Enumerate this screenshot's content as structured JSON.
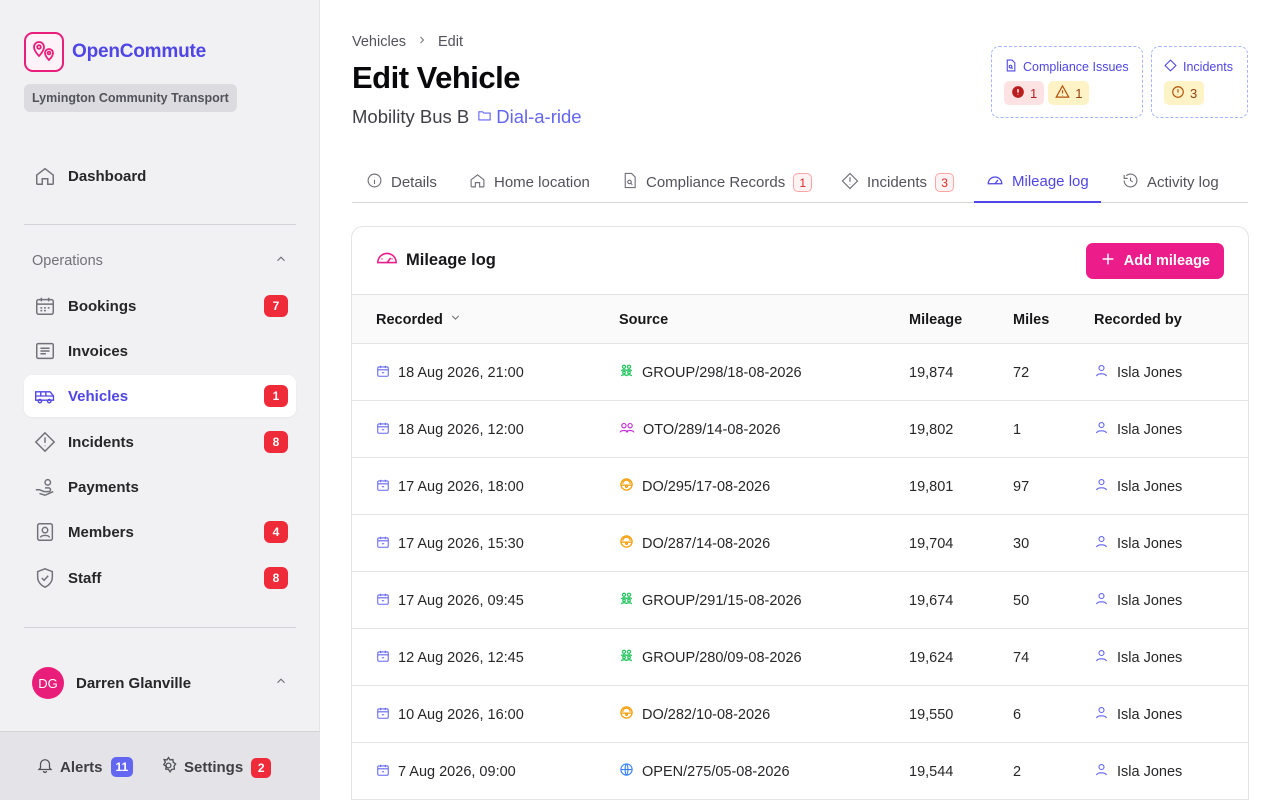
{
  "app": {
    "name": "OpenCommute",
    "organisation": "Lymington Community Transport"
  },
  "sidebar": {
    "dashboard": "Dashboard",
    "section_title": "Operations",
    "items": [
      {
        "label": "Bookings",
        "badge": "7"
      },
      {
        "label": "Invoices",
        "badge": ""
      },
      {
        "label": "Vehicles",
        "badge": "1"
      },
      {
        "label": "Incidents",
        "badge": "8"
      },
      {
        "label": "Payments",
        "badge": ""
      },
      {
        "label": "Members",
        "badge": "4"
      },
      {
        "label": "Staff",
        "badge": "8"
      }
    ],
    "user": {
      "initials": "DG",
      "name": "Darren Glanville"
    },
    "footer": {
      "alerts_label": "Alerts",
      "alerts_count": "11",
      "settings_label": "Settings",
      "settings_count": "2"
    }
  },
  "breadcrumb": {
    "parent": "Vehicles",
    "current": "Edit"
  },
  "page": {
    "title": "Edit Vehicle",
    "vehicle_name": "Mobility Bus B",
    "service": "Dial-a-ride"
  },
  "status_cards": {
    "compliance": {
      "label": "Compliance Issues",
      "critical": "1",
      "warning": "1"
    },
    "incidents": {
      "label": "Incidents",
      "count": "3"
    }
  },
  "tabs": [
    {
      "label": "Details",
      "count": ""
    },
    {
      "label": "Home location",
      "count": ""
    },
    {
      "label": "Compliance Records",
      "count": "1"
    },
    {
      "label": "Incidents",
      "count": "3"
    },
    {
      "label": "Mileage log",
      "count": ""
    },
    {
      "label": "Activity log",
      "count": ""
    }
  ],
  "panel": {
    "title": "Mileage log",
    "add_button": "Add mileage",
    "columns": [
      "Recorded",
      "Source",
      "Mileage",
      "Miles",
      "Recorded by"
    ],
    "rows": [
      {
        "recorded": "18 Aug 2026, 21:00",
        "source": "GROUP/298/18-08-2026",
        "source_type": "group",
        "mileage": "19,874",
        "miles": "72",
        "by": "Isla Jones"
      },
      {
        "recorded": "18 Aug 2026, 12:00",
        "source": "OTO/289/14-08-2026",
        "source_type": "oto",
        "mileage": "19,802",
        "miles": "1",
        "by": "Isla Jones"
      },
      {
        "recorded": "17 Aug 2026, 18:00",
        "source": "DO/295/17-08-2026",
        "source_type": "do",
        "mileage": "19,801",
        "miles": "97",
        "by": "Isla Jones"
      },
      {
        "recorded": "17 Aug 2026, 15:30",
        "source": "DO/287/14-08-2026",
        "source_type": "do",
        "mileage": "19,704",
        "miles": "30",
        "by": "Isla Jones"
      },
      {
        "recorded": "17 Aug 2026, 09:45",
        "source": "GROUP/291/15-08-2026",
        "source_type": "group",
        "mileage": "19,674",
        "miles": "50",
        "by": "Isla Jones"
      },
      {
        "recorded": "12 Aug 2026, 12:45",
        "source": "GROUP/280/09-08-2026",
        "source_type": "group",
        "mileage": "19,624",
        "miles": "74",
        "by": "Isla Jones"
      },
      {
        "recorded": "10 Aug 2026, 16:00",
        "source": "DO/282/10-08-2026",
        "source_type": "do",
        "mileage": "19,550",
        "miles": "6",
        "by": "Isla Jones"
      },
      {
        "recorded": "7 Aug 2026, 09:00",
        "source": "OPEN/275/05-08-2026",
        "source_type": "open",
        "mileage": "19,544",
        "miles": "2",
        "by": "Isla Jones"
      }
    ]
  },
  "colors": {
    "accent": "#4f46e5",
    "brand_pink": "#ec1c8a",
    "badge_red": "#ef2b3a",
    "alerts_badge": "#6366f1"
  }
}
